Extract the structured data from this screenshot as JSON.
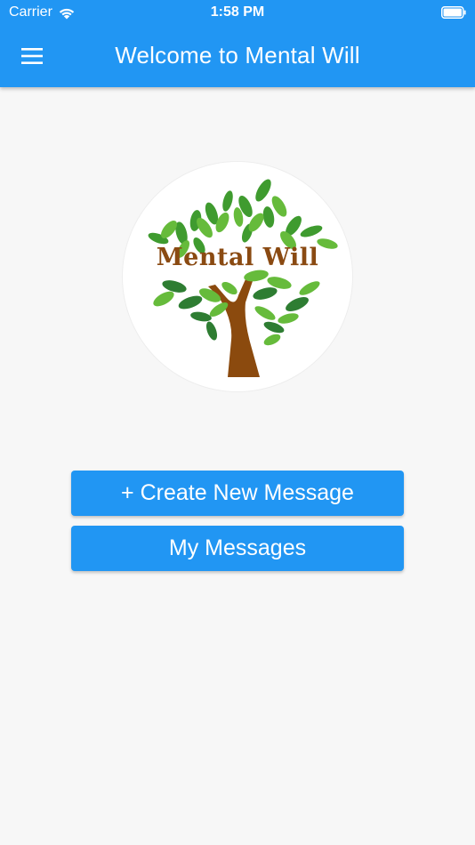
{
  "status_bar": {
    "carrier": "Carrier",
    "time": "1:58 PM"
  },
  "appbar": {
    "title": "Welcome to Mental Will",
    "menu_icon": "hamburger-menu-icon",
    "color": "#2196f3"
  },
  "logo": {
    "text": "Mental Will",
    "text_color": "#8a4a12",
    "leaf_colors": [
      "#3f9b2f",
      "#66bb3b",
      "#2e7d32"
    ],
    "trunk_color": "#8b4a0e"
  },
  "buttons": {
    "create_label": "+ Create New Message",
    "messages_label": "My Messages",
    "color": "#2196f3"
  }
}
